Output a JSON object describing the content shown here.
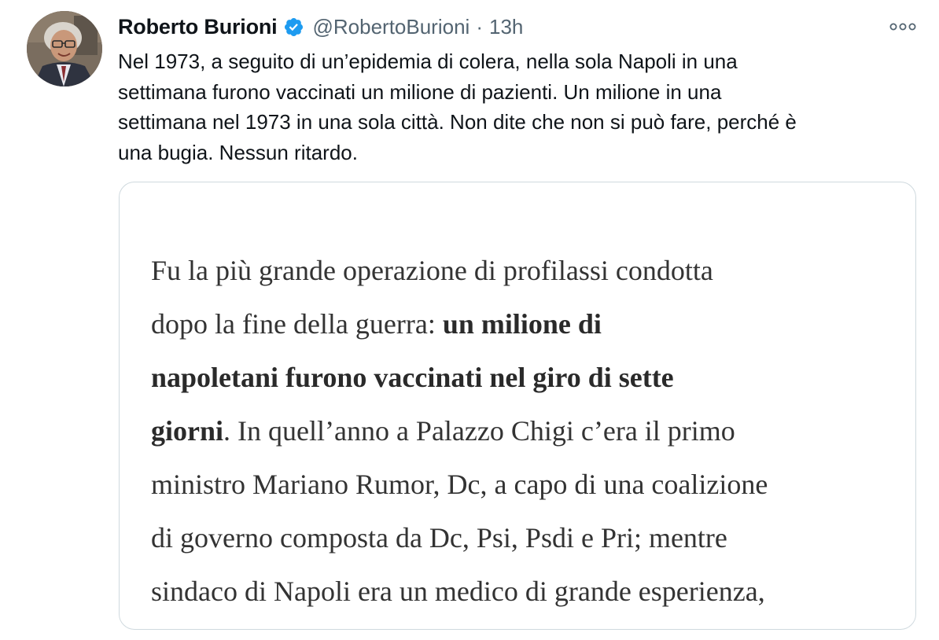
{
  "tweet": {
    "author": {
      "display_name": "Roberto Burioni",
      "handle": "@RobertoBurioni",
      "verified": true
    },
    "separator": "·",
    "timestamp": "13h",
    "text_lines": [
      "Nel 1973, a seguito di un’epidemia di colera, nella sola Napoli in una",
      "settimana furono vaccinati un milione di pazienti. Un milione in una",
      "settimana nel 1973 in una sola città. Non dite che non si può fare, perché è",
      "una bugia. Nessun ritardo."
    ],
    "media": {
      "lines": [
        {
          "plain": "Fu la più grande operazione di profilassi condotta"
        },
        {
          "plain": "dopo la fine della guerra: ",
          "bold": "un milione di"
        },
        {
          "bold": "napoletani furono vaccinati nel giro di sette"
        },
        {
          "bold": "giorni",
          "plain": ". In quell’anno a Palazzo Chigi c’era il primo"
        },
        {
          "plain": "ministro Mariano Rumor, Dc, a capo di una coalizione"
        },
        {
          "plain": "di governo composta da Dc, Psi, Psdi e Pri; mentre"
        },
        {
          "plain": "sindaco di Napoli era un medico di grande esperienza,"
        }
      ]
    }
  },
  "icons": {
    "verified": "verified-badge-icon",
    "more": "more-options-icon"
  },
  "colors": {
    "verified_blue": "#1d9bf0",
    "text_primary": "#0f1419",
    "text_secondary": "#536471",
    "card_border": "#cfd9de",
    "quote_text": "#333333"
  }
}
